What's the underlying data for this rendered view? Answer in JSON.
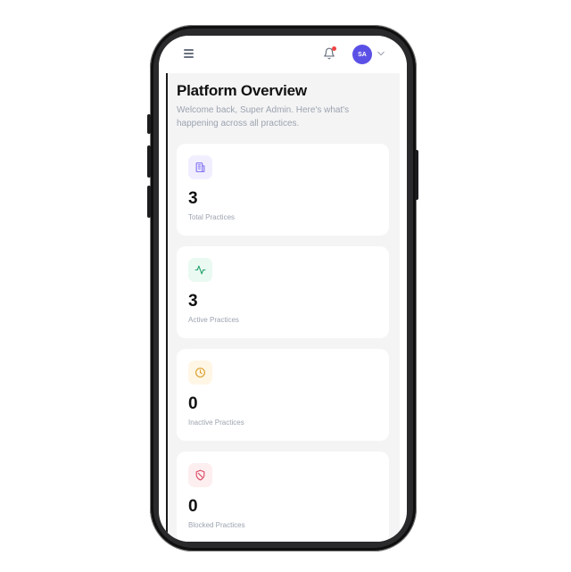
{
  "header": {
    "menu_icon": "hamburger-menu-icon",
    "notification_icon": "bell-icon",
    "avatar_initials": "SA",
    "dropdown_icon": "chevron-down-icon",
    "notification_dot_color": "#ef4444",
    "avatar_color": "#5b50e6"
  },
  "page": {
    "title": "Platform Overview",
    "subtitle": "Welcome back, Super Admin. Here's what's happening across all practices."
  },
  "stats": [
    {
      "value": "3",
      "label": "Total Practices",
      "icon": "building-icon",
      "icon_color": "#7c6cf0",
      "icon_bg": "#f1efff"
    },
    {
      "value": "3",
      "label": "Active Practices",
      "icon": "activity-icon",
      "icon_color": "#22a06b",
      "icon_bg": "#eafaf2"
    },
    {
      "value": "0",
      "label": "Inactive Practices",
      "icon": "clock-icon",
      "icon_color": "#d99a1e",
      "icon_bg": "#fff6e6"
    },
    {
      "value": "0",
      "label": "Blocked Practices",
      "icon": "shield-off-icon",
      "icon_color": "#d9455f",
      "icon_bg": "#fdeef0"
    }
  ]
}
